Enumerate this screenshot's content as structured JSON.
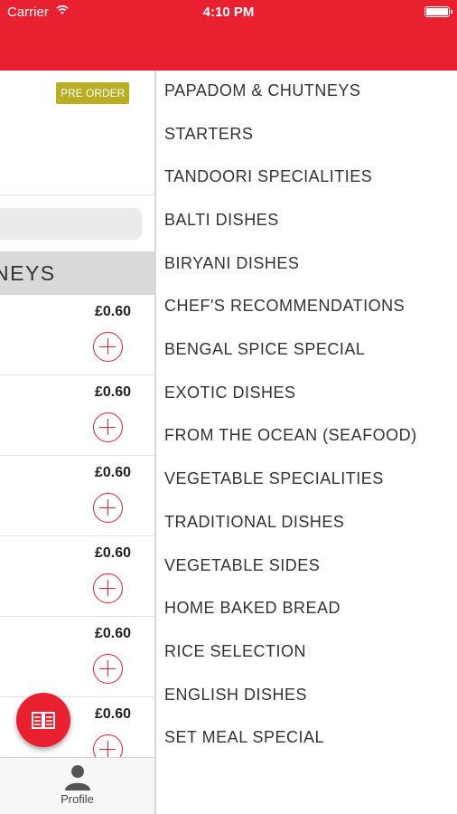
{
  "status_bar": {
    "carrier": "Carrier",
    "time": "4:10 PM"
  },
  "colors": {
    "brand_red": "#e8202f",
    "preorder_badge": "#b9ad22"
  },
  "left_panel": {
    "badge": "PRE ORDER",
    "category_header": "NEYS",
    "items": [
      {
        "price": "£0.60"
      },
      {
        "price": "£0.60"
      },
      {
        "price": "£0.60"
      },
      {
        "price": "£0.60"
      },
      {
        "price": "£0.60"
      },
      {
        "price": "£0.60"
      }
    ],
    "fab_icon": "menu-book-icon"
  },
  "tabbar": {
    "profile_label": "Profile"
  },
  "menu": {
    "items": [
      "PAPADOM & CHUTNEYS",
      "STARTERS",
      "TANDOORI SPECIALITIES",
      "BALTI DISHES",
      "BIRYANI DISHES",
      "CHEF'S RECOMMENDATIONS",
      "BENGAL SPICE SPECIAL",
      "EXOTIC DISHES",
      "FROM THE OCEAN (SEAFOOD)",
      "VEGETABLE SPECIALITIES",
      "TRADITIONAL DISHES",
      "VEGETABLE SIDES",
      "HOME BAKED BREAD",
      "RICE SELECTION",
      "ENGLISH DISHES",
      "SET MEAL SPECIAL"
    ]
  }
}
